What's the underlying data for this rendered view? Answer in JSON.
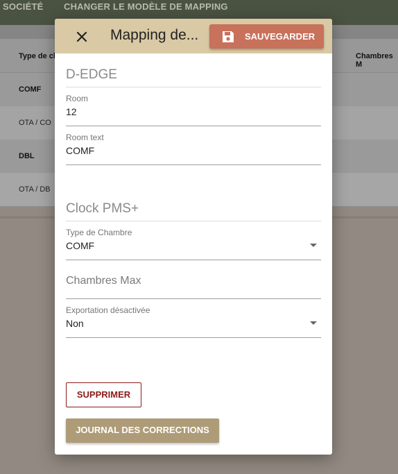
{
  "app": {
    "nav": {
      "tab_societe": "SOCIÉTÉ",
      "tab_change_model": "CHANGER LE MODÈLE DE MAPPING"
    },
    "table": {
      "col_type": "Type de ch",
      "col_chambres": "Chambres M",
      "rows": [
        "COMF",
        "OTA / CO",
        "DBL",
        "OTA / DB"
      ]
    }
  },
  "dialog": {
    "title": "Mapping de...",
    "close_icon": "close-icon",
    "save": {
      "label": "SAUVEGARDER",
      "icon": "floppy-disk-icon"
    },
    "source_section": {
      "title": "D-EDGE",
      "room": {
        "label": "Room",
        "value": "12"
      },
      "room_text": {
        "label": "Room text",
        "value": "COMF"
      }
    },
    "target_section": {
      "title": "Clock PMS+",
      "type_chambre": {
        "label": "Type de Chambre",
        "value": "COMF"
      },
      "chambres_max": {
        "placeholder": "Chambres Max"
      },
      "exportation": {
        "label": "Exportation désactivée",
        "value": "Non"
      }
    },
    "delete_label": "SUPPRIMER",
    "journal_label": "JOURNAL DES CORRECTIONS"
  },
  "colors": {
    "header_bg": "#d9c9a4",
    "save_button": "#c8715b",
    "journal_button": "#ae9c78",
    "delete_accent": "#8b1a1a",
    "topbar": "#4a5242"
  }
}
